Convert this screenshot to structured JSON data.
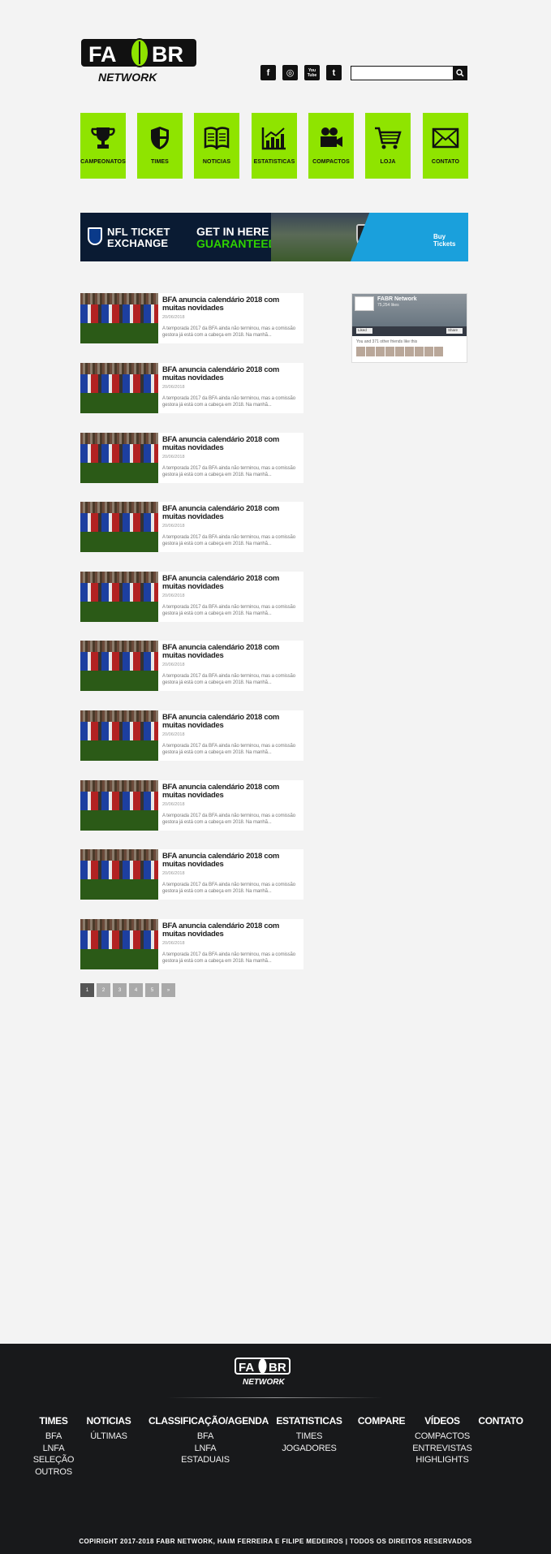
{
  "header": {
    "logo_text_top": "FA BR",
    "logo_text_bottom": "NETWORK",
    "social": [
      {
        "name": "facebook-icon",
        "glyph": "f"
      },
      {
        "name": "instagram-icon",
        "glyph": "◎"
      },
      {
        "name": "youtube-icon",
        "glyph": "You Tube"
      },
      {
        "name": "twitter-icon",
        "glyph": "t"
      }
    ],
    "search_placeholder": ""
  },
  "categories": [
    {
      "label": "CAMPEONATOS",
      "icon": "trophy-icon"
    },
    {
      "label": "TIMES",
      "icon": "shield-icon"
    },
    {
      "label": "NOTICIAS",
      "icon": "book-icon"
    },
    {
      "label": "ESTATISTICAS",
      "icon": "chart-icon"
    },
    {
      "label": "COMPACTOS",
      "icon": "video-camera-icon"
    },
    {
      "label": "LOJA",
      "icon": "cart-icon"
    },
    {
      "label": "CONTATO",
      "icon": "envelope-icon"
    }
  ],
  "banner": {
    "line1": "NFL TICKET",
    "line2": "EXCHANGE",
    "cta_a": "GET IN HERE",
    "cta_b": "GUARANTEED",
    "buy": "Buy Tickets",
    "tm_a": "ticketmaster",
    "tm_b": "verified"
  },
  "articles": [
    {
      "title": "BFA anuncia calendário 2018 com muitas novidades",
      "date": "20/06/2018",
      "excerpt": "A temporada 2017 da BFA ainda não terminou, mas a comissão gestora já está com a cabeça em 2018. Na manhã..."
    },
    {
      "title": "BFA anuncia calendário 2018 com muitas novidades",
      "date": "20/06/2018",
      "excerpt": "A temporada 2017 da BFA ainda não terminou, mas a comissão gestora já está com a cabeça em 2018. Na manhã..."
    },
    {
      "title": "BFA anuncia calendário 2018 com muitas novidades",
      "date": "20/06/2018",
      "excerpt": "A temporada 2017 da BFA ainda não terminou, mas a comissão gestora já está com a cabeça em 2018. Na manhã..."
    },
    {
      "title": "BFA anuncia calendário 2018 com muitas novidades",
      "date": "20/06/2018",
      "excerpt": "A temporada 2017 da BFA ainda não terminou, mas a comissão gestora já está com a cabeça em 2018. Na manhã..."
    },
    {
      "title": "BFA anuncia calendário 2018 com muitas novidades",
      "date": "20/06/2018",
      "excerpt": "A temporada 2017 da BFA ainda não terminou, mas a comissão gestora já está com a cabeça em 2018. Na manhã..."
    },
    {
      "title": "BFA anuncia calendário 2018 com muitas novidades",
      "date": "20/06/2018",
      "excerpt": "A temporada 2017 da BFA ainda não terminou, mas a comissão gestora já está com a cabeça em 2018. Na manhã..."
    },
    {
      "title": "BFA anuncia calendário 2018 com muitas novidades",
      "date": "20/06/2018",
      "excerpt": "A temporada 2017 da BFA ainda não terminou, mas a comissão gestora já está com a cabeça em 2018. Na manhã..."
    },
    {
      "title": "BFA anuncia calendário 2018 com muitas novidades",
      "date": "20/06/2018",
      "excerpt": "A temporada 2017 da BFA ainda não terminou, mas a comissão gestora já está com a cabeça em 2018. Na manhã..."
    },
    {
      "title": "BFA anuncia calendário 2018 com muitas novidades",
      "date": "20/06/2018",
      "excerpt": "A temporada 2017 da BFA ainda não terminou, mas a comissão gestora já está com a cabeça em 2018. Na manhã..."
    },
    {
      "title": "BFA anuncia calendário 2018 com muitas novidades",
      "date": "20/06/2018",
      "excerpt": "A temporada 2017 da BFA ainda não terminou, mas a comissão gestora já está com a cabeça em 2018. Na manhã..."
    }
  ],
  "fb_widget": {
    "page_name": "FABR Network",
    "likes": "75,254 likes",
    "like_btn": "Liked",
    "share_btn": "Share",
    "friends": "You and 371 other friends like this"
  },
  "pagination": [
    "1",
    "2",
    "3",
    "4",
    "5",
    "»"
  ],
  "footer": {
    "columns": [
      {
        "heading": "TIMES",
        "items": [
          "BFA",
          "LNFA",
          "SELEÇÃO",
          "OUTROS"
        ]
      },
      {
        "heading": "NOTICIAS",
        "items": [
          "ÚLTIMAS"
        ]
      },
      {
        "heading": "CLASSIFICAÇÃO/AGENDA",
        "items": [
          "BFA",
          "LNFA",
          "ESTADUAIS"
        ]
      },
      {
        "heading": "ESTATISTICAS",
        "items": [
          "TIMES",
          "JOGADORES"
        ]
      },
      {
        "heading": "COMPARE",
        "items": []
      },
      {
        "heading": "VÍDEOS",
        "items": [
          "COMPACTOS",
          "ENTREVISTAS",
          "HIGHLIGHTS"
        ]
      },
      {
        "heading": "CONTATO",
        "items": []
      }
    ],
    "copyright": "COPIRIGHT 2017-2018 FABR NETWORK, HAIM FERREIRA E FILIPE MEDEIROS | TODOS OS DIREITOS RESERVADOS"
  },
  "colors": {
    "accent": "#8fe400",
    "footer_bg": "#18191b",
    "page_bg": "#f3f3f3"
  }
}
